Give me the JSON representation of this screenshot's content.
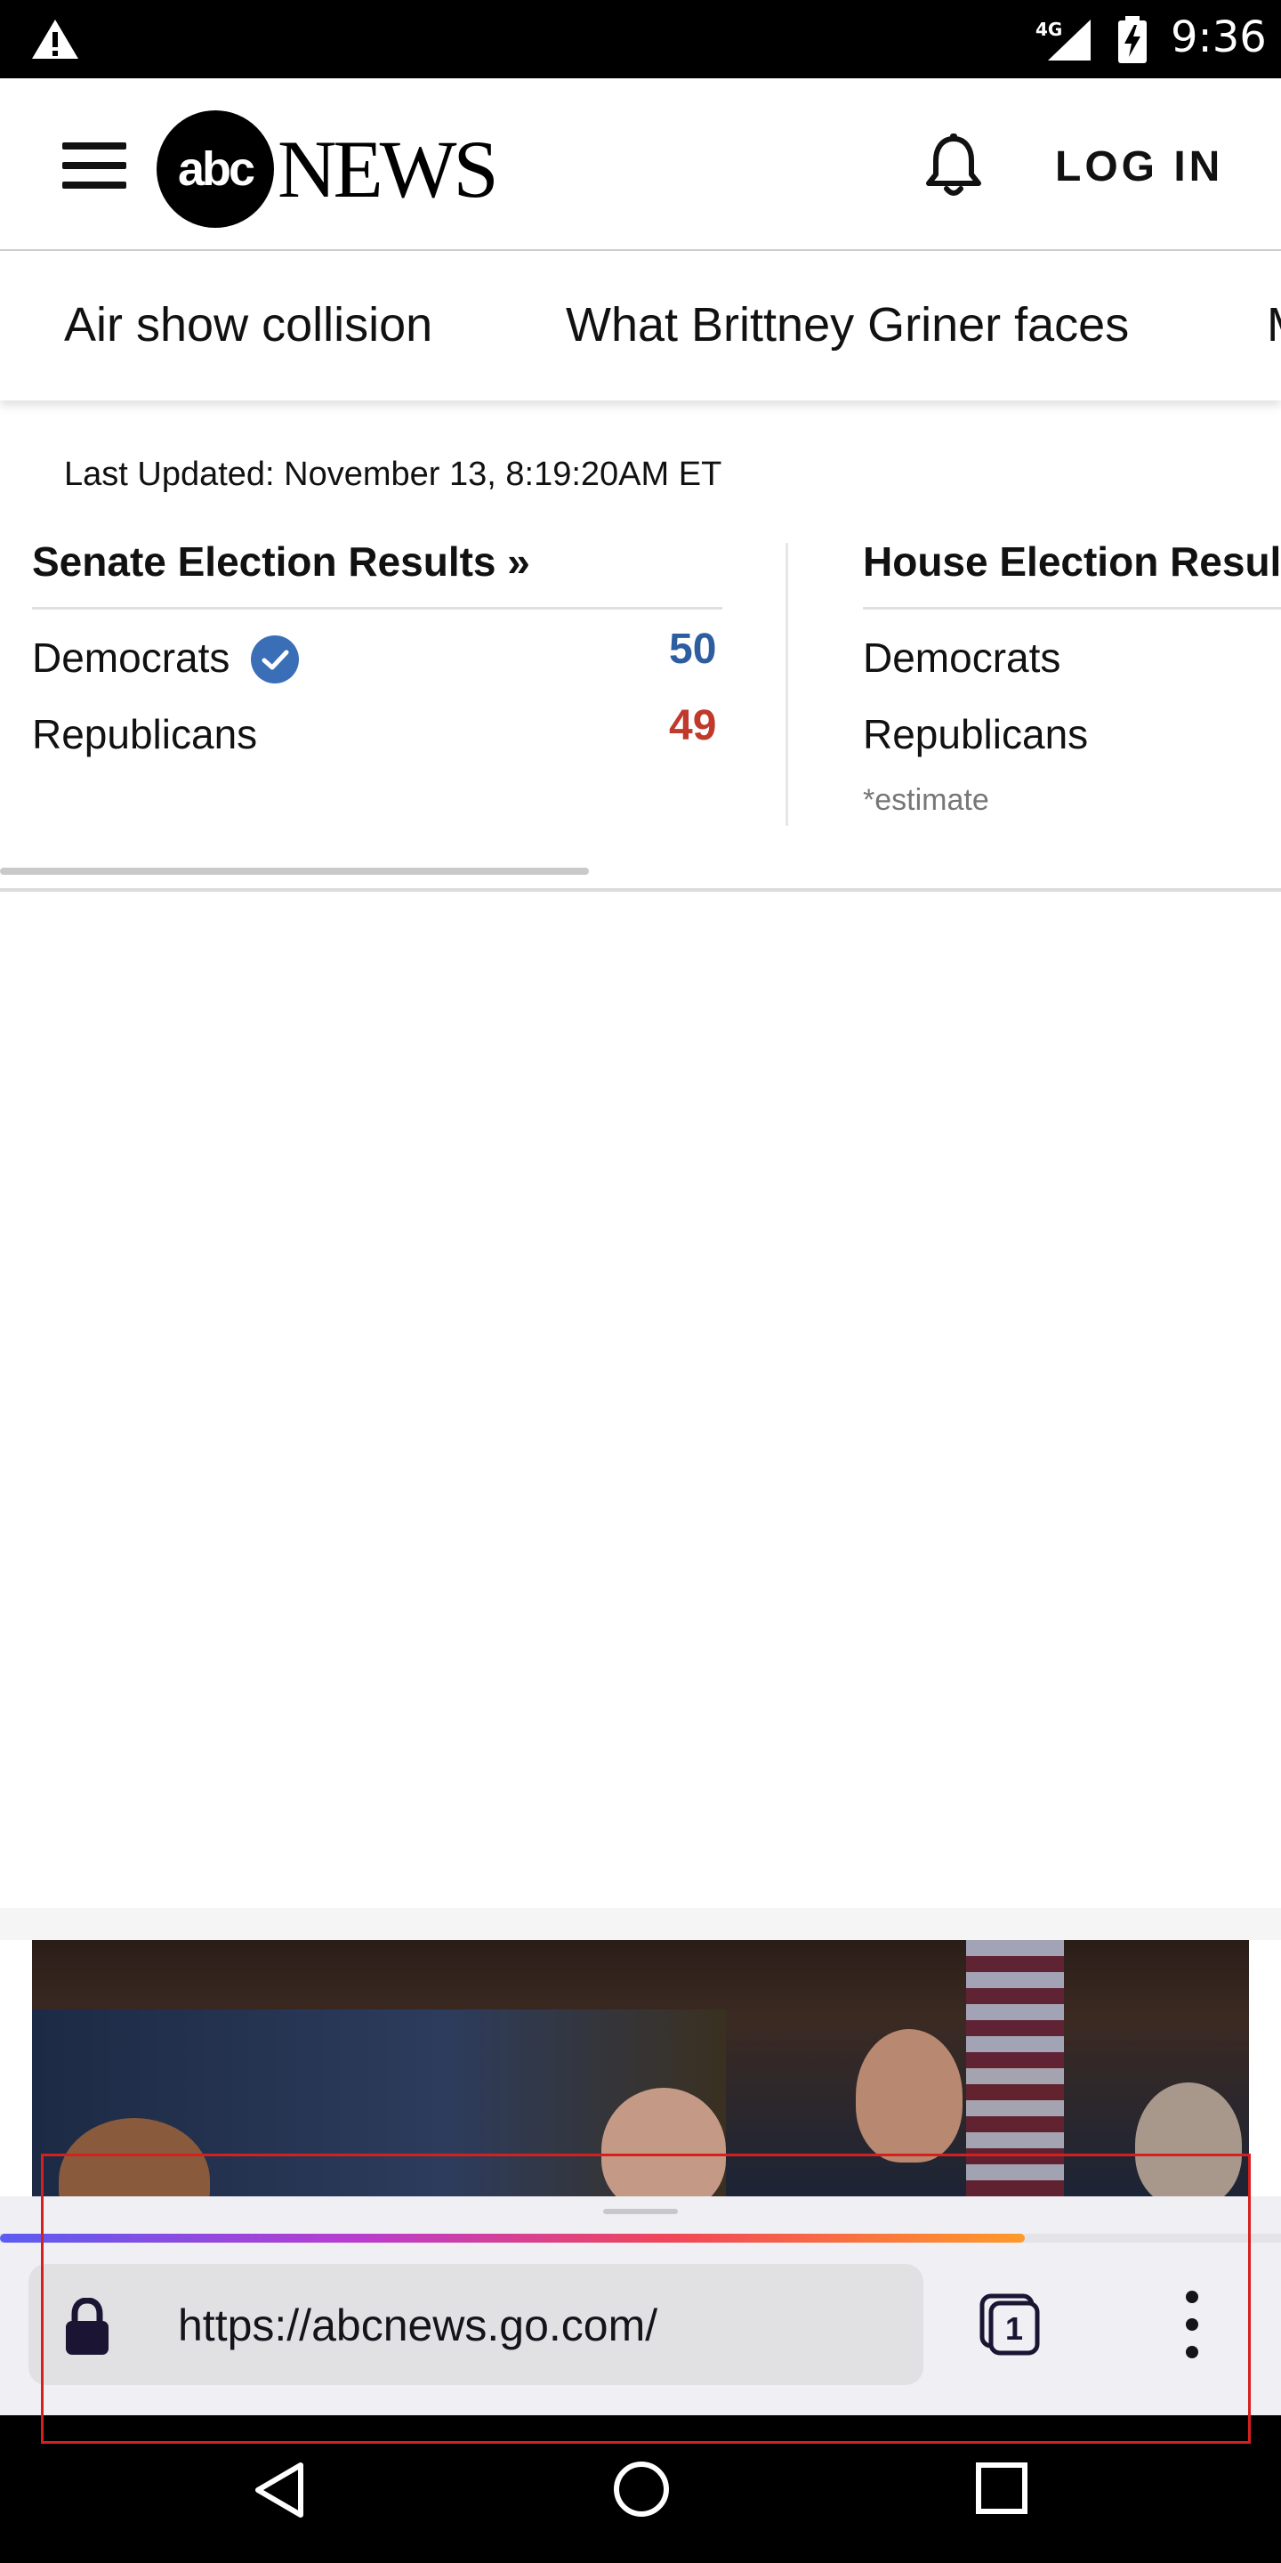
{
  "status_bar": {
    "network": "4G",
    "time": "9:36"
  },
  "header": {
    "logo_abc": "abc",
    "logo_news": "NEWS",
    "login_label": "LOG IN"
  },
  "trending": {
    "items": [
      "Air show collision",
      "What Brittney Griner faces",
      "M"
    ]
  },
  "elections": {
    "last_updated": "Last Updated: November 13, 8:19:20AM ET",
    "senate": {
      "title": "Senate Election Results »",
      "democrats_label": "Democrats",
      "democrats_seats": "50",
      "republicans_label": "Republicans",
      "republicans_seats": "49",
      "colors": {
        "democrats": "#2c5ea0",
        "republicans": "#c0392b"
      }
    },
    "house": {
      "title": "House Election Resul",
      "democrats_label": "Democrats",
      "republicans_label": "Republicans",
      "note": "*estimate"
    }
  },
  "browser": {
    "url": "https://abcnews.go.com/",
    "tab_count": "1",
    "load_progress": 0.8,
    "icons": [
      "lock-icon",
      "tabs-icon",
      "more-options-icon"
    ]
  },
  "system_nav": {
    "icons": [
      "back-icon",
      "home-icon",
      "recents-icon"
    ]
  }
}
